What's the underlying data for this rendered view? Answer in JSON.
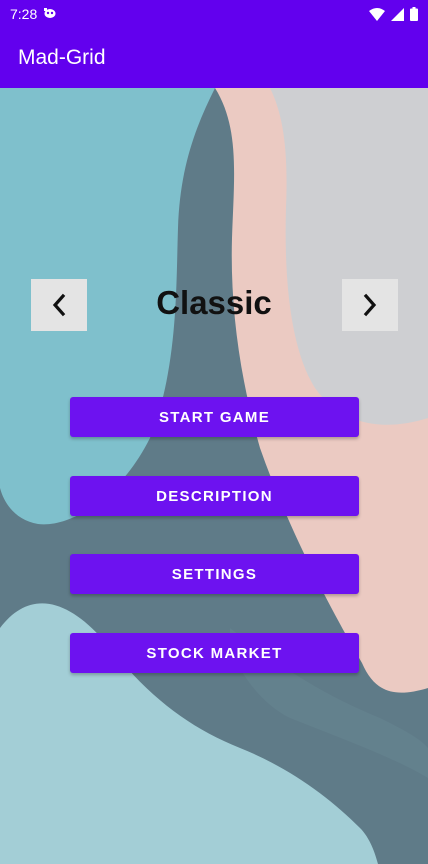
{
  "status_bar": {
    "time": "7:28",
    "icons": [
      "notification-icon",
      "wifi-icon",
      "signal-icon",
      "battery-icon"
    ]
  },
  "app_bar": {
    "title": "Mad-Grid"
  },
  "mode_selector": {
    "current_mode": "Classic",
    "prev_icon": "chevron-left-icon",
    "next_icon": "chevron-right-icon"
  },
  "menu": {
    "start_game": "START GAME",
    "description": "DESCRIPTION",
    "settings": "SETTINGS",
    "stock_market": "STOCK MARKET"
  },
  "colors": {
    "primary": "#6200ee",
    "button": "#6d12f0",
    "arrow_button_bg": "#e4e4e4"
  }
}
